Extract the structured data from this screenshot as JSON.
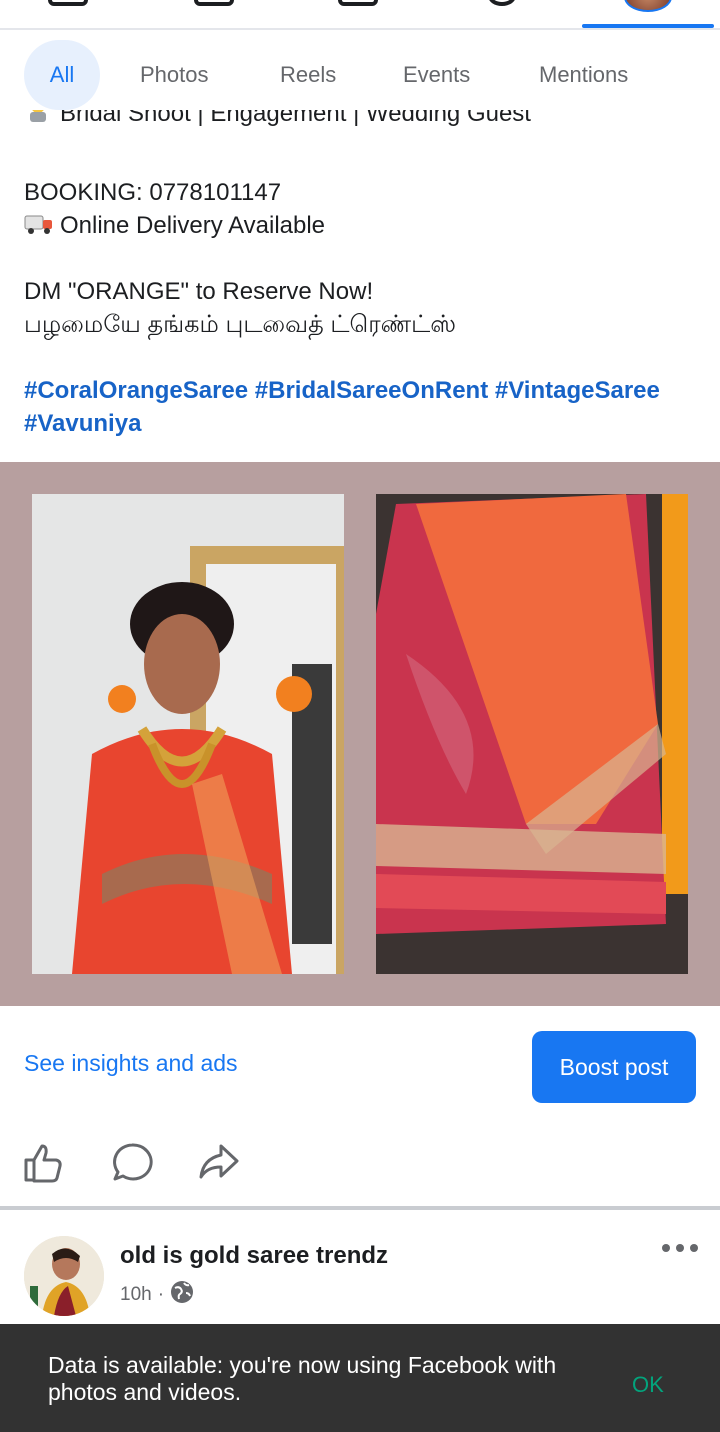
{
  "tabs": [
    "All",
    "Photos",
    "Reels",
    "Events",
    "Mentions"
  ],
  "post": {
    "cut_line": "Bridal Shoot | Engagement | Wedding Guest",
    "booking": "BOOKING: 0778101147",
    "delivery": "Online Delivery Available",
    "dm": "DM \"ORANGE\" to Reserve Now!",
    "tamil": "பழமையே தங்கம் புடவைத் ட்ரெண்ட்ஸ்",
    "hashtags_line1": "#CoralOrangeSaree #BridalSareeOnRent #VintageSaree",
    "hashtags_line2": "#Vavuniya"
  },
  "insights_label": "See insights and ads",
  "boost_label": "Boost post",
  "next_post": {
    "name": "old is gold saree trendz",
    "time": "10h",
    "separator": "·"
  },
  "snackbar": {
    "message": "Data is available: you're now using Facebook with photos and videos.",
    "action": "OK"
  },
  "icons": [
    "like-icon",
    "comment-icon",
    "share-icon",
    "globe-icon",
    "more-icon"
  ],
  "colors": {
    "accent": "#1877f2",
    "media_bg": "#b79f9f",
    "snackbar_bg": "#323232",
    "snack_action": "#03a37c"
  }
}
